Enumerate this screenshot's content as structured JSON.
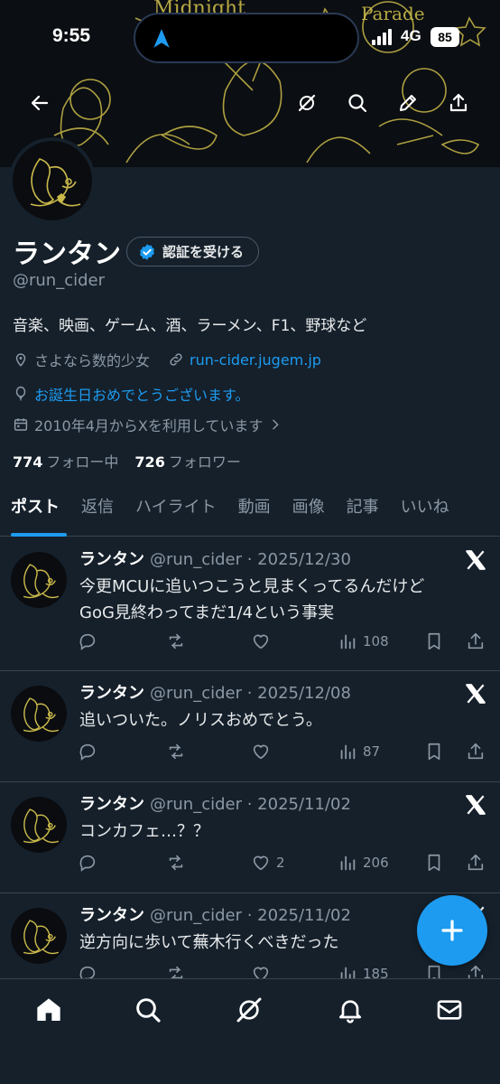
{
  "status_bar": {
    "time": "9:55",
    "network": "4G",
    "battery": "85"
  },
  "profile": {
    "name": "ランタン",
    "verify_button": "認証を受ける",
    "handle": "@run_cider",
    "bio": "音楽、映画、ゲーム、酒、ラーメン、F1、野球など",
    "location": "さよなら数的少女",
    "website": "run-cider.jugem.jp",
    "birthday": "お誕生日おめでとうございます。",
    "joined": "2010年4月からXを利用しています",
    "following_count": "774",
    "following_label": "フォロー中",
    "followers_count": "726",
    "followers_label": "フォロワー"
  },
  "tabs": [
    {
      "label": "ポスト"
    },
    {
      "label": "返信"
    },
    {
      "label": "ハイライト"
    },
    {
      "label": "動画"
    },
    {
      "label": "画像"
    },
    {
      "label": "記事"
    },
    {
      "label": "いいね"
    }
  ],
  "posts": [
    {
      "author": "ランタン",
      "meta": "@run_cider · 2025/12/30",
      "lines": [
        "今更MCUに追いつこうと見まくってるんだけど",
        "GoG見終わってまだ1/4という事実"
      ],
      "likes": "",
      "views": "108"
    },
    {
      "author": "ランタン",
      "meta": "@run_cider · 2025/12/08",
      "lines": [
        "追いついた。ノリスおめでとう。"
      ],
      "likes": "",
      "views": "87"
    },
    {
      "author": "ランタン",
      "meta": "@run_cider · 2025/11/02",
      "lines": [
        "コンカフェ…？？"
      ],
      "likes": "2",
      "views": "206"
    },
    {
      "author": "ランタン",
      "meta": "@run_cider · 2025/11/02",
      "lines": [
        "逆方向に歩いて蕪木行くべきだった"
      ],
      "likes": "",
      "views": "185"
    }
  ],
  "colors": {
    "accent": "#1d9bf0",
    "background": "#15202b",
    "secondary_text": "#8b98a5",
    "border": "#38444d"
  },
  "icons": [
    "back-arrow-icon",
    "grok-icon",
    "search-icon",
    "compose-icon",
    "share-icon",
    "verified-badge-icon",
    "location-icon",
    "link-icon",
    "balloon-icon",
    "calendar-icon",
    "reply-icon",
    "repost-icon",
    "like-icon",
    "views-icon",
    "bookmark-icon",
    "x-logo-icon",
    "plus-icon",
    "home-icon",
    "notifications-icon",
    "messages-icon"
  ]
}
